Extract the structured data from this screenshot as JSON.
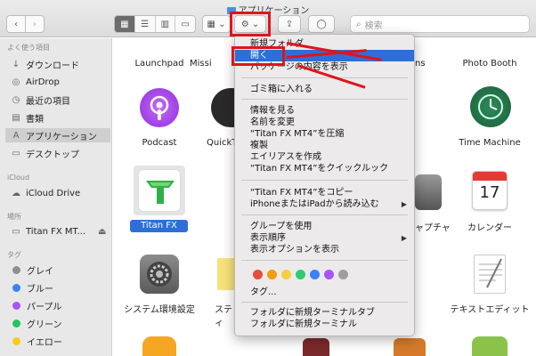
{
  "window": {
    "title": "アプリケーション"
  },
  "toolbar": {
    "back": "‹",
    "forward": "›",
    "views": [
      "▦",
      "☰",
      "▥",
      "▭"
    ],
    "group": "▦ ⌄",
    "action": "⚙ ⌄",
    "share": "⇪",
    "tag": "◯",
    "search_placeholder": "検索",
    "search_glyph": "⌕"
  },
  "sidebar": {
    "favorites_header": "よく使う項目",
    "favorites": [
      {
        "label": "ダウンロード",
        "icon": "↓"
      },
      {
        "label": "AirDrop",
        "icon": "◎"
      },
      {
        "label": "最近の項目",
        "icon": "◷"
      },
      {
        "label": "書類",
        "icon": "▤"
      },
      {
        "label": "アプリケーション",
        "icon": "A"
      },
      {
        "label": "デスクトップ",
        "icon": "▭"
      }
    ],
    "icloud_header": "iCloud",
    "icloud": [
      {
        "label": "iCloud Drive",
        "icon": "☁"
      }
    ],
    "locations_header": "場所",
    "locations": [
      {
        "label": "Titan FX MT...",
        "icon": "▭",
        "eject": "⏏"
      }
    ],
    "tags_header": "タグ",
    "tags": [
      {
        "label": "グレイ",
        "color": "#8e8e93"
      },
      {
        "label": "ブルー",
        "color": "#3b82f6"
      },
      {
        "label": "パープル",
        "color": "#a855f7"
      },
      {
        "label": "グリーン",
        "color": "#22c55e"
      },
      {
        "label": "イエロー",
        "color": "#facc15"
      }
    ]
  },
  "apps": {
    "launchpad": "Launchpad",
    "mission": "Missi",
    "photobooth": "Photo Booth",
    "podcast": "Podcast",
    "quicktime": "QuickT",
    "timemachine": "Time Machine",
    "titan": "Titan FX MT4",
    "screenshot": "ャプチャ",
    "calendar": "カレンダー",
    "calendar_day": "17",
    "sysprefs": "システム環境設定",
    "stickies": "スティ",
    "textedit": "テキストエディット",
    "partial_right": "ns"
  },
  "context_menu": {
    "items_top": [
      "新規フォルダ",
      "開く",
      "パッケージの内容を表示"
    ],
    "trash": "ゴミ箱に入れる",
    "info_group": [
      "情報を見る",
      "名前を変更",
      "“Titan FX MT4”を圧縮",
      "複製",
      "エイリアスを作成",
      "“Titan FX MT4”をクイックルック"
    ],
    "copy_group": [
      "“Titan FX MT4”をコピー",
      "iPhoneまたはiPadから読み込む"
    ],
    "view_group": [
      "グループを使用",
      "表示順序",
      "表示オプションを表示"
    ],
    "tag_colors": [
      "#e74c3c",
      "#f39c12",
      "#f4d03f",
      "#2ecc71",
      "#3b82f6",
      "#a855f7",
      "#9e9e9e"
    ],
    "tags_item": "タグ...",
    "terminal_group": [
      "フォルダに新規ターミナルタブ",
      "フォルダに新規ターミナル"
    ],
    "submenu_arrow": "▶"
  }
}
